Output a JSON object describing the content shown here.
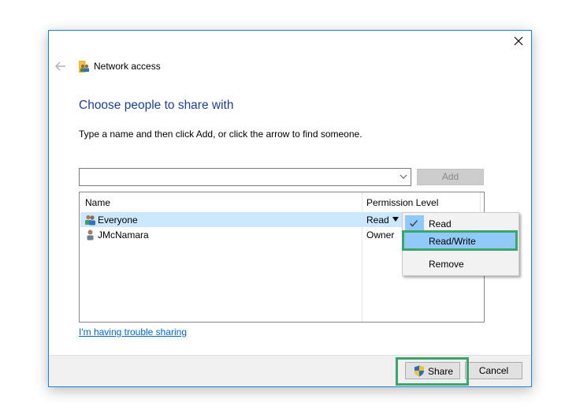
{
  "window": {
    "nav_title": "Network access",
    "heading": "Choose people to share with",
    "instruction": "Type a name and then click Add, or click the arrow to find someone."
  },
  "name_input": {
    "value": "",
    "placeholder": ""
  },
  "add_button": {
    "label": "Add",
    "enabled": false
  },
  "list": {
    "columns": [
      "Name",
      "Permission Level"
    ],
    "rows": [
      {
        "name": "Everyone",
        "permission": "Read",
        "icon": "group-icon",
        "selected": true
      },
      {
        "name": "JMcNamara",
        "permission": "Owner",
        "icon": "user-icon",
        "selected": false
      }
    ]
  },
  "permission_menu": {
    "items": [
      {
        "label": "Read",
        "checked": true
      },
      {
        "label": "Read/Write",
        "checked": false,
        "hovered": true
      },
      {
        "label": "Remove",
        "checked": false
      }
    ]
  },
  "trouble_link": "I'm having trouble sharing",
  "footer": {
    "share_label": "Share",
    "cancel_label": "Cancel"
  },
  "colors": {
    "heading": "#1c3f9e",
    "selection": "#cce8ff",
    "menu_hover": "#91c9f7",
    "highlight_box": "#3ba56b",
    "window_border": "#1883d7",
    "link": "#0066cc"
  }
}
